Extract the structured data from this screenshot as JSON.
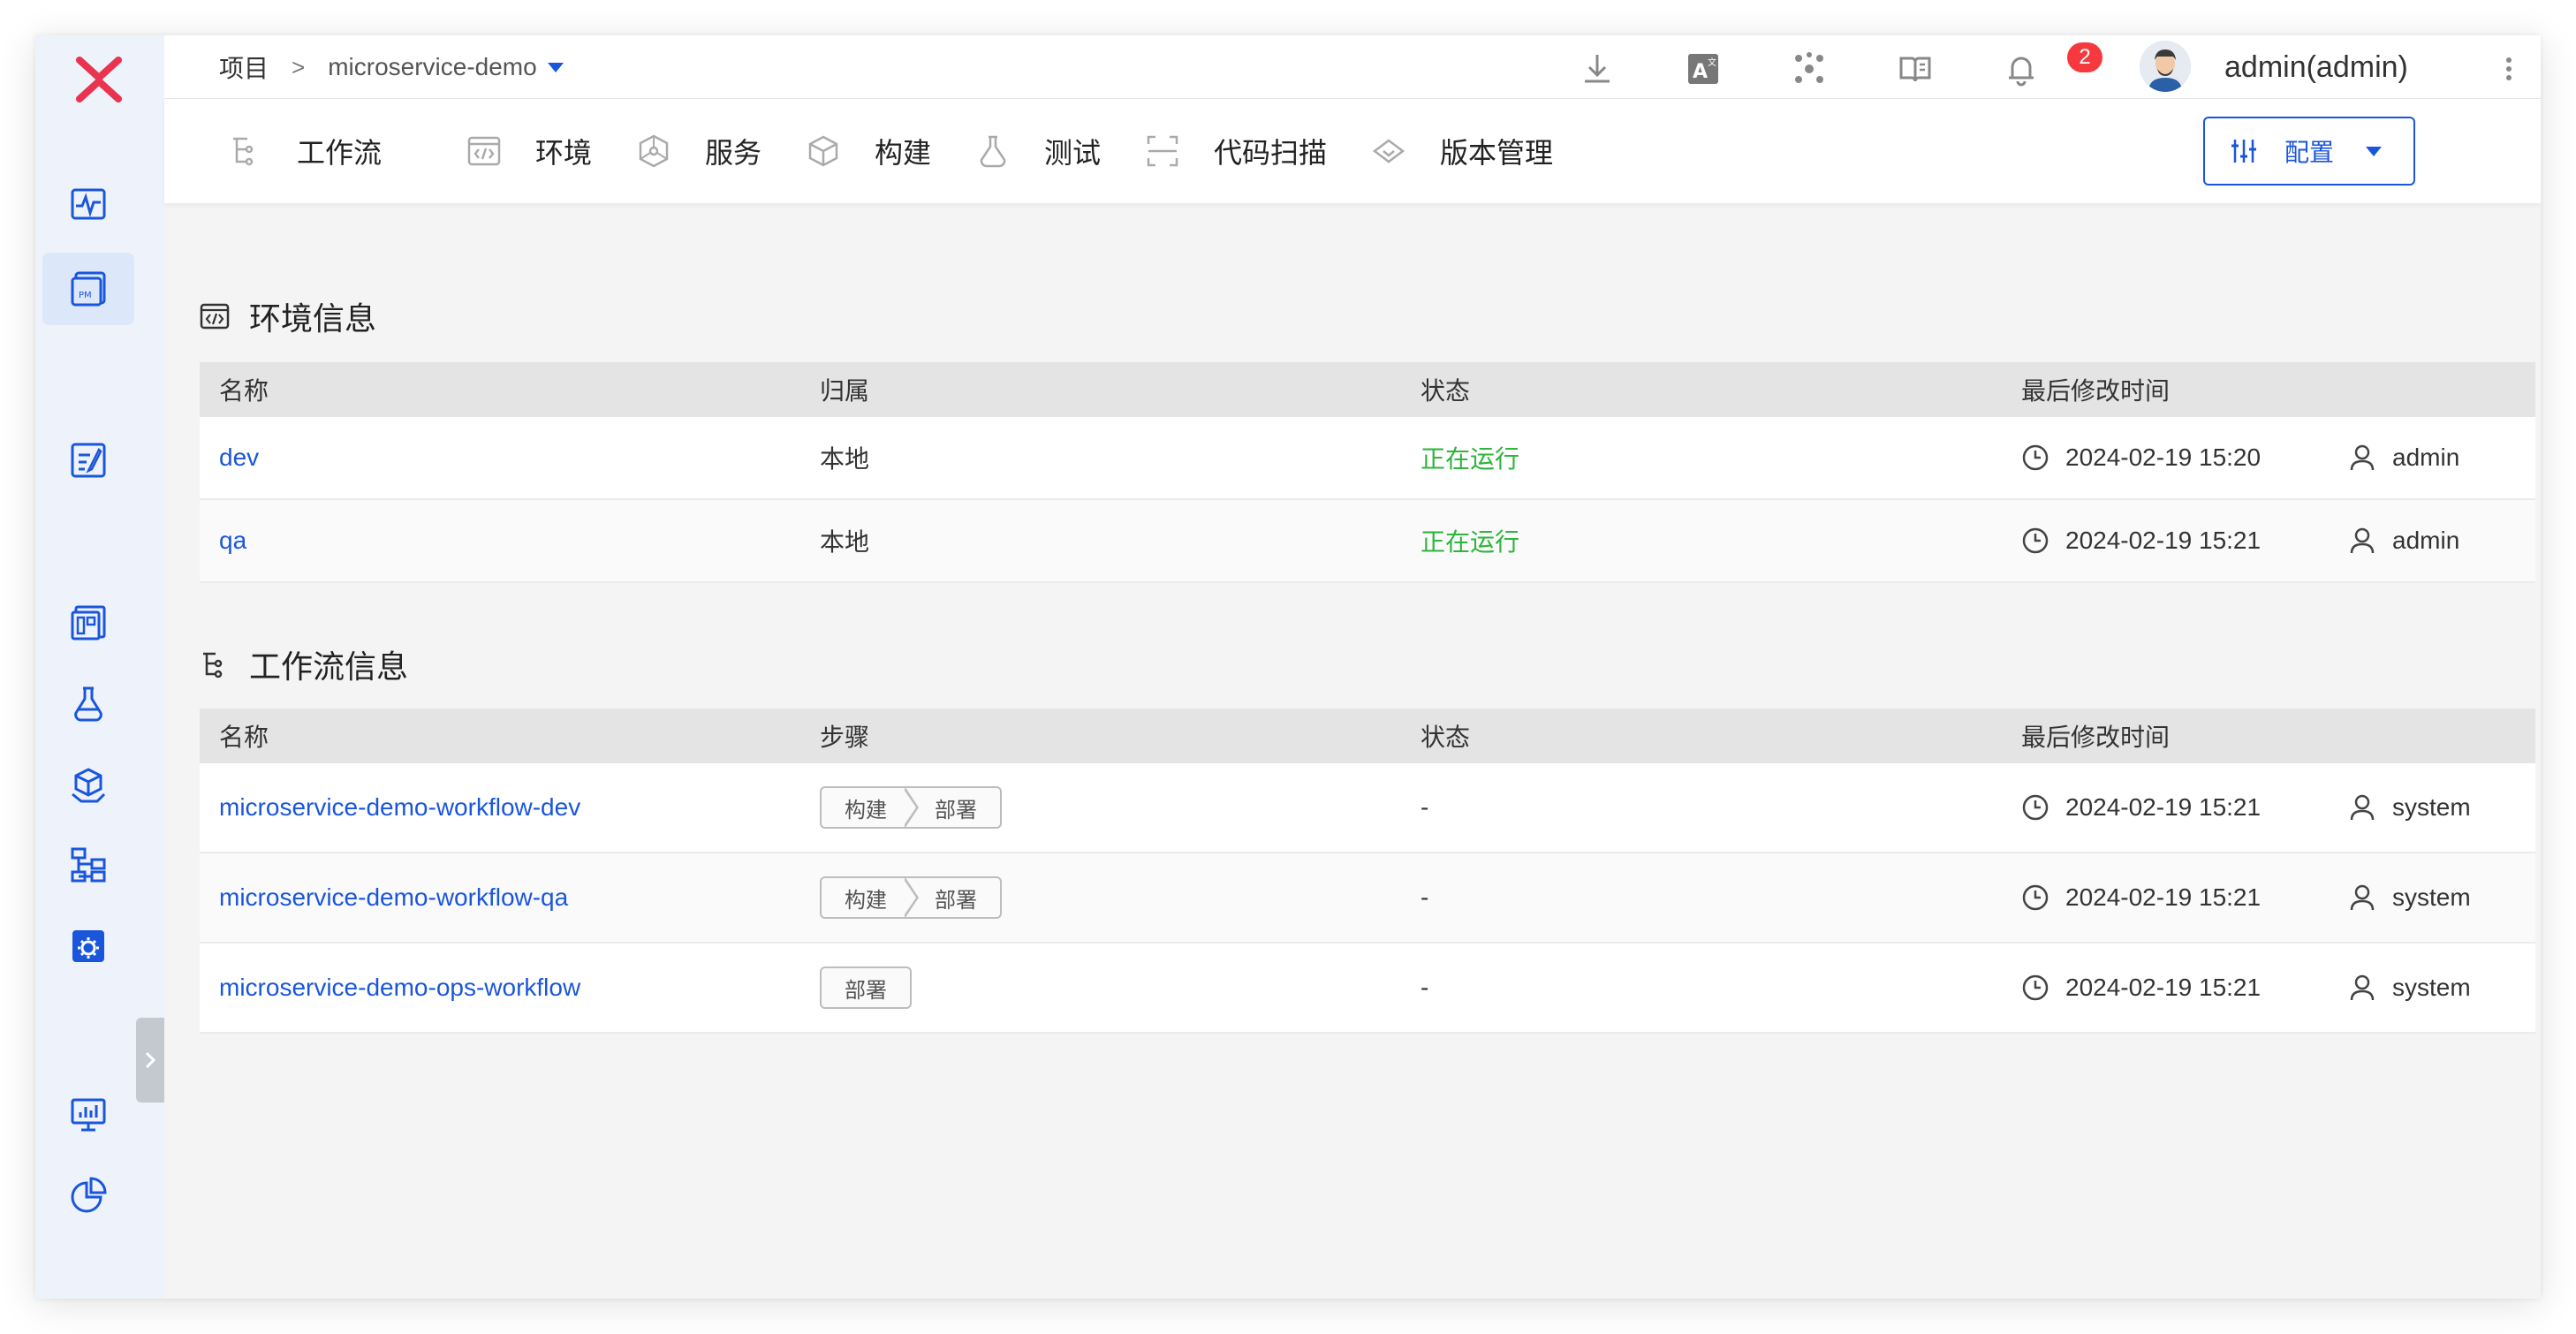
{
  "header": {
    "breadcrumb_root": "项目",
    "breadcrumb_sep": ">",
    "project_name": "microservice-demo",
    "notification_count": "2",
    "username": "admin(admin)"
  },
  "tabs": [
    {
      "label": "工作流",
      "icon": "workflow-icon"
    },
    {
      "label": "环境",
      "icon": "environment-icon"
    },
    {
      "label": "服务",
      "icon": "service-icon"
    },
    {
      "label": "构建",
      "icon": "build-icon"
    },
    {
      "label": "测试",
      "icon": "test-flask-icon"
    },
    {
      "label": "代码扫描",
      "icon": "code-scan-icon"
    },
    {
      "label": "版本管理",
      "icon": "version-icon"
    }
  ],
  "config_button": {
    "label": "配置"
  },
  "env_section": {
    "title": "环境信息",
    "columns": [
      "名称",
      "归属",
      "状态",
      "最后修改时间"
    ],
    "rows": [
      {
        "name": "dev",
        "owner": "本地",
        "status": "正在运行",
        "time": "2024-02-19 15:20",
        "user": "admin"
      },
      {
        "name": "qa",
        "owner": "本地",
        "status": "正在运行",
        "time": "2024-02-19 15:21",
        "user": "admin"
      }
    ]
  },
  "workflow_section": {
    "title": "工作流信息",
    "columns": [
      "名称",
      "步骤",
      "状态",
      "最后修改时间"
    ],
    "rows": [
      {
        "name": "microservice-demo-workflow-dev",
        "steps": [
          "构建",
          "部署"
        ],
        "status": "-",
        "time": "2024-02-19 15:21",
        "user": "system"
      },
      {
        "name": "microservice-demo-workflow-qa",
        "steps": [
          "构建",
          "部署"
        ],
        "status": "-",
        "time": "2024-02-19 15:21",
        "user": "system"
      },
      {
        "name": "microservice-demo-ops-workflow",
        "steps": [
          "部署"
        ],
        "status": "-",
        "time": "2024-02-19 15:21",
        "user": "system"
      }
    ]
  },
  "colors": {
    "accent": "#1a56db",
    "running": "#2fb43d",
    "logo": "#e8344e",
    "badge": "#f5393f"
  }
}
